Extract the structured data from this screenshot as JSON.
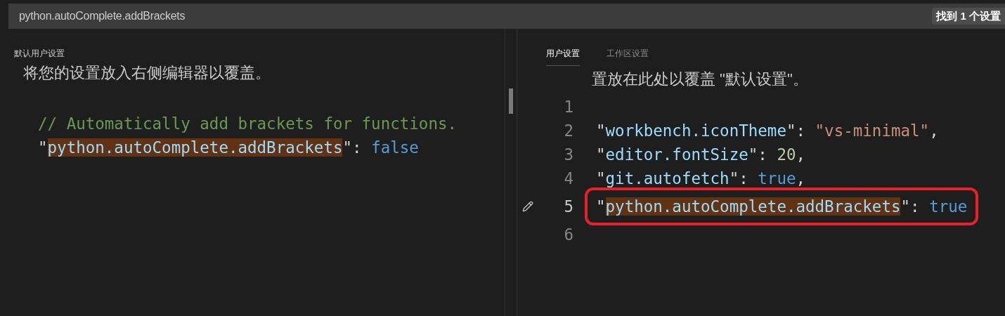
{
  "search": {
    "value": "python.autoComplete.addBrackets",
    "result_badge": "找到 1 个设置"
  },
  "left": {
    "title": "默认用户设置",
    "header_text": "将您的设置放入右侧编辑器以覆盖。",
    "lines": [
      {
        "tokens": [
          {
            "kind": "comment",
            "text": "// Automatically add brackets for functions."
          }
        ]
      },
      {
        "tokens": [
          {
            "kind": "punct",
            "text": "\""
          },
          {
            "kind": "matched_key",
            "text": "python.autoComplete.addBrackets"
          },
          {
            "kind": "punct",
            "text": "\": "
          },
          {
            "kind": "bool",
            "text": "false"
          }
        ]
      }
    ]
  },
  "right": {
    "tabs": [
      {
        "label": "用户设置",
        "selected": true
      },
      {
        "label": "工作区设置",
        "selected": false
      }
    ],
    "header_text": "置放在此处以覆盖 \"默认设置\"。",
    "lines": [
      {
        "number": "1",
        "edited": false,
        "annotated": false
      },
      {
        "number": "2",
        "edited": false,
        "annotated": false,
        "tokens": [
          {
            "kind": "punct",
            "text": "\""
          },
          {
            "kind": "key",
            "text": "workbench.iconTheme"
          },
          {
            "kind": "punct",
            "text": "\": "
          },
          {
            "kind": "string",
            "text": "\"vs-minimal\""
          },
          {
            "kind": "punct",
            "text": ","
          }
        ]
      },
      {
        "number": "3",
        "edited": false,
        "annotated": false,
        "tokens": [
          {
            "kind": "punct",
            "text": "\""
          },
          {
            "kind": "key",
            "text": "editor.fontSize"
          },
          {
            "kind": "punct",
            "text": "\": "
          },
          {
            "kind": "number",
            "text": "20"
          },
          {
            "kind": "punct",
            "text": ","
          }
        ]
      },
      {
        "number": "4",
        "edited": false,
        "annotated": false,
        "tokens": [
          {
            "kind": "punct",
            "text": "\""
          },
          {
            "kind": "key",
            "text": "git.autofetch"
          },
          {
            "kind": "punct",
            "text": "\": "
          },
          {
            "kind": "bool",
            "text": "true"
          },
          {
            "kind": "punct",
            "text": ","
          }
        ]
      },
      {
        "number": "5",
        "edited": true,
        "annotated": true,
        "tokens": [
          {
            "kind": "punct",
            "text": "\""
          },
          {
            "kind": "matched_key",
            "text": "python.autoComplete.addBrackets"
          },
          {
            "kind": "punct",
            "text": "\": "
          },
          {
            "kind": "bool",
            "text": "true"
          }
        ]
      },
      {
        "number": "6",
        "edited": false,
        "annotated": false
      }
    ]
  }
}
